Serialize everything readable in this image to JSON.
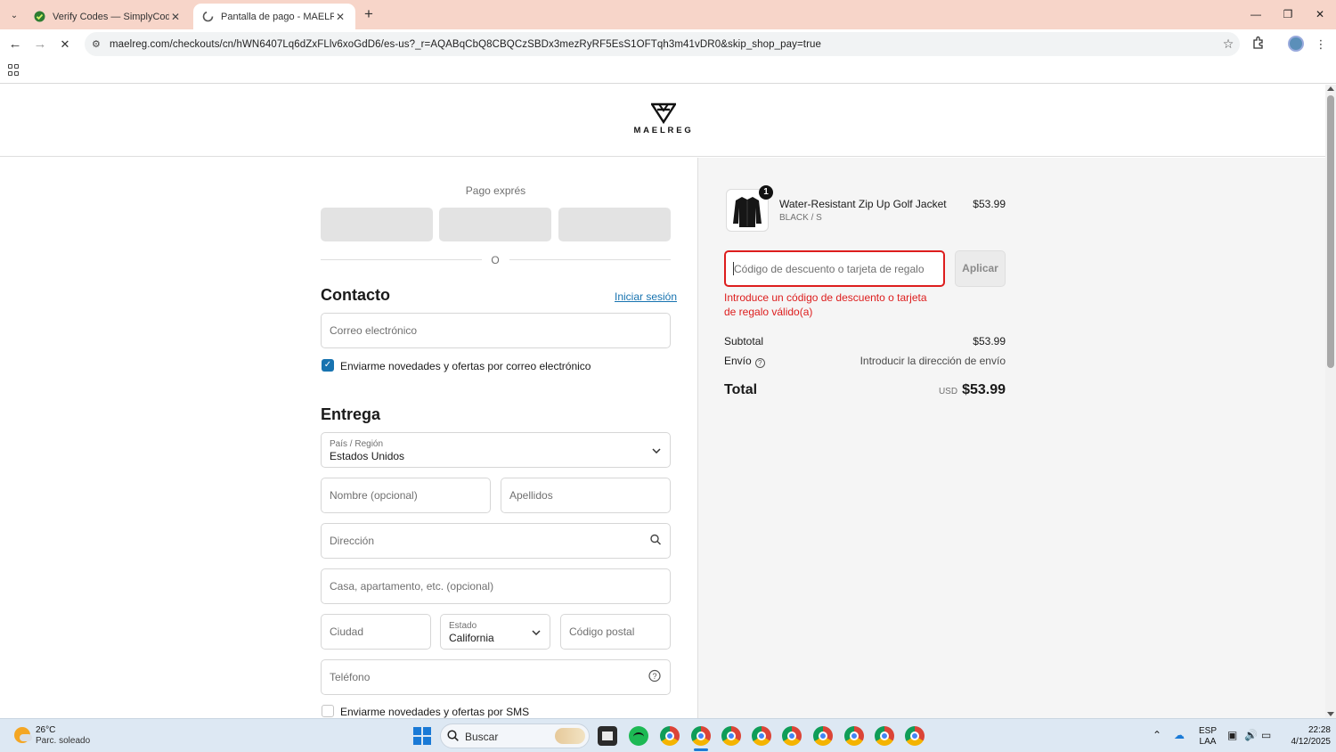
{
  "browser": {
    "tabs": [
      {
        "title": "Verify Codes — SimplyCodes",
        "favicon": "simplycodes-icon"
      },
      {
        "title": "Pantalla de pago - MAELREG",
        "favicon": "loading-icon"
      }
    ],
    "url": "maelreg.com/checkouts/cn/hWN6407Lq6dZxFLlv6xoGdD6/es-us?_r=AQABqCbQ8CBQCzSBDx3mezRyRF5EsS1OFTqh3m41vDR0&skip_shop_pay=true"
  },
  "store": {
    "name": "MAELREG"
  },
  "express": {
    "title": "Pago exprés",
    "divider": "O"
  },
  "contact": {
    "title": "Contacto",
    "login_link": "Iniciar sesión",
    "email_placeholder": "Correo electrónico",
    "newsletter_label": "Enviarme novedades y ofertas por correo electrónico",
    "newsletter_checked": true
  },
  "delivery": {
    "title": "Entrega",
    "country_label": "País / Región",
    "country_value": "Estados Unidos",
    "first_name_placeholder": "Nombre (opcional)",
    "last_name_placeholder": "Apellidos",
    "address_placeholder": "Dirección",
    "apartment_placeholder": "Casa, apartamento, etc. (opcional)",
    "city_placeholder": "Ciudad",
    "state_label": "Estado",
    "state_value": "California",
    "zip_placeholder": "Código postal",
    "phone_placeholder": "Teléfono",
    "sms_label": "Enviarme novedades y ofertas por SMS",
    "sms_checked": false
  },
  "summary": {
    "item": {
      "name": "Water-Resistant Zip Up Golf Jacket",
      "variant": "BLACK / S",
      "price": "$53.99",
      "quantity": "1"
    },
    "discount_placeholder": "Código de descuento o tarjeta de regalo",
    "apply_label": "Aplicar",
    "error": "Introduce un código de descuento o tarjeta de regalo válido(a)",
    "subtotal_label": "Subtotal",
    "subtotal_value": "$53.99",
    "shipping_label": "Envío",
    "shipping_value": "Introducir la dirección de envío",
    "total_label": "Total",
    "total_currency": "USD",
    "total_value": "$53.99"
  },
  "taskbar": {
    "weather_temp": "26°C",
    "weather_desc": "Parc. soleado",
    "search_label": "Buscar",
    "lang_top": "ESP",
    "lang_bottom": "LAA",
    "time": "22:28",
    "date": "4/12/2025"
  },
  "colors": {
    "error": "#dd1d1d",
    "link": "#1773b0",
    "checkbox": "#1773b0"
  }
}
